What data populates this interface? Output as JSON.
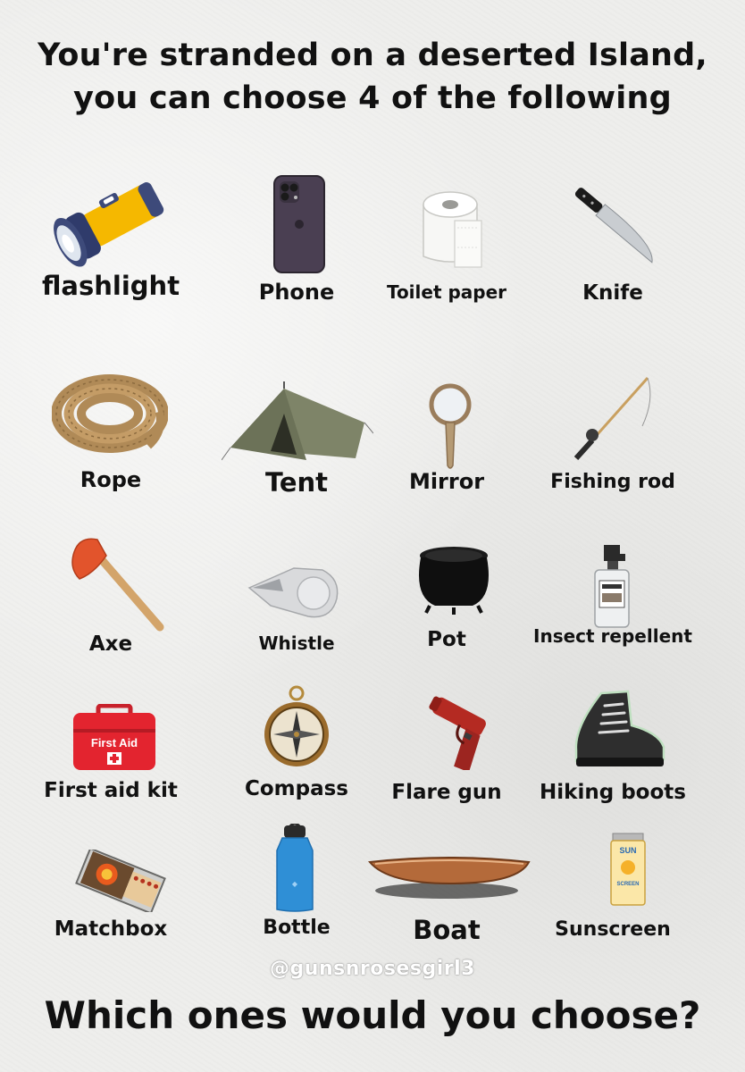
{
  "title": {
    "line1": "You're stranded on a deserted Island,",
    "line2": "you can choose 4 of the following"
  },
  "items": [
    {
      "label": "flashlight",
      "icon": "flashlight-icon"
    },
    {
      "label": "Phone",
      "icon": "phone-icon"
    },
    {
      "label": "Toilet paper",
      "icon": "toilet-paper-icon"
    },
    {
      "label": "Knife",
      "icon": "knife-icon"
    },
    {
      "label": "Rope",
      "icon": "rope-icon"
    },
    {
      "label": "Tent",
      "icon": "tent-icon"
    },
    {
      "label": "Mirror",
      "icon": "mirror-icon"
    },
    {
      "label": "Fishing rod",
      "icon": "fishing-rod-icon"
    },
    {
      "label": "Axe",
      "icon": "axe-icon"
    },
    {
      "label": "Whistle",
      "icon": "whistle-icon"
    },
    {
      "label": "Pot",
      "icon": "pot-icon"
    },
    {
      "label": "Insect repellent",
      "icon": "insect-repellent-icon"
    },
    {
      "label": "First aid kit",
      "icon": "first-aid-kit-icon",
      "icon_text": "First Aid"
    },
    {
      "label": "Compass",
      "icon": "compass-icon"
    },
    {
      "label": "Flare gun",
      "icon": "flare-gun-icon"
    },
    {
      "label": "Hiking boots",
      "icon": "hiking-boots-icon"
    },
    {
      "label": "Matchbox",
      "icon": "matchbox-icon"
    },
    {
      "label": "Bottle",
      "icon": "bottle-icon"
    },
    {
      "label": "Boat",
      "icon": "boat-icon"
    },
    {
      "label": "Sunscreen",
      "icon": "sunscreen-icon",
      "icon_text_1": "SUN",
      "icon_text_2": "SCREEN"
    }
  ],
  "watermark": "@gunsnrosesgirl3",
  "question": "Which ones would you choose?"
}
